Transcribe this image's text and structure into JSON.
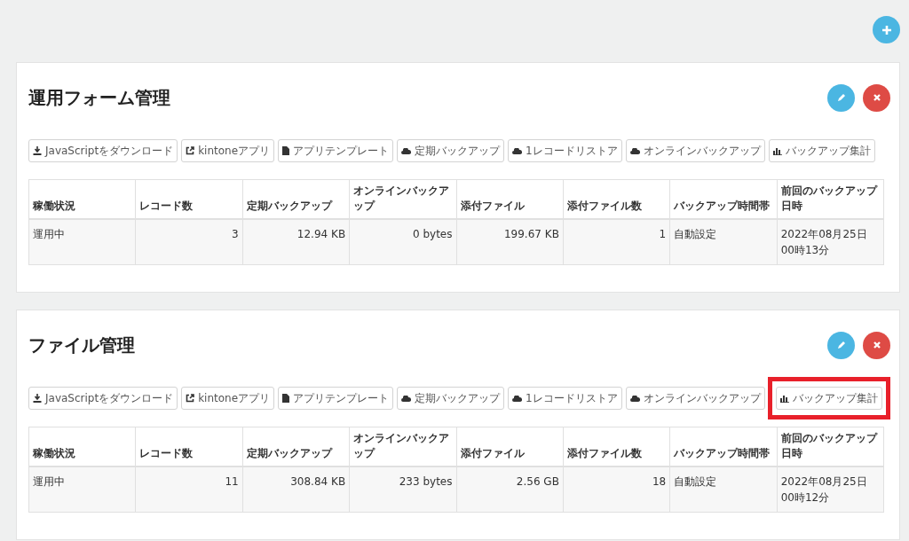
{
  "panels": [
    {
      "title": "運用フォーム管理",
      "buttons": [
        {
          "label": "JavaScriptをダウンロード",
          "kind": "download",
          "highlighted": false
        },
        {
          "label": "kintoneアプリ",
          "kind": "external",
          "highlighted": false
        },
        {
          "label": "アプリテンプレート",
          "kind": "file",
          "highlighted": false
        },
        {
          "label": "定期バックアップ",
          "kind": "cloud",
          "highlighted": false
        },
        {
          "label": "1レコードリストア",
          "kind": "cloud",
          "highlighted": false
        },
        {
          "label": "オンラインバックアップ",
          "kind": "cloud",
          "highlighted": false
        },
        {
          "label": "バックアップ集計",
          "kind": "chart",
          "highlighted": false
        }
      ],
      "table": {
        "columns": [
          {
            "label": "稼働状況",
            "kind": "text"
          },
          {
            "label": "レコード数",
            "kind": "number"
          },
          {
            "label": "定期バックアップ",
            "kind": "number"
          },
          {
            "label": "オンラインバックアップ",
            "kind": "number"
          },
          {
            "label": "添付ファイル",
            "kind": "number"
          },
          {
            "label": "添付ファイル数",
            "kind": "number"
          },
          {
            "label": "バックアップ時間帯",
            "kind": "text"
          },
          {
            "label": "前回のバックアップ日時",
            "kind": "text"
          }
        ],
        "rows": [
          [
            "運用中",
            "3",
            "12.94 KB",
            "0 bytes",
            "199.67 KB",
            "1",
            "自動設定",
            "2022年08月25日00時13分"
          ]
        ]
      }
    },
    {
      "title": "ファイル管理",
      "buttons": [
        {
          "label": "JavaScriptをダウンロード",
          "kind": "download",
          "highlighted": false
        },
        {
          "label": "kintoneアプリ",
          "kind": "external",
          "highlighted": false
        },
        {
          "label": "アプリテンプレート",
          "kind": "file",
          "highlighted": false
        },
        {
          "label": "定期バックアップ",
          "kind": "cloud",
          "highlighted": false
        },
        {
          "label": "1レコードリストア",
          "kind": "cloud",
          "highlighted": false
        },
        {
          "label": "オンラインバックアップ",
          "kind": "cloud",
          "highlighted": false
        },
        {
          "label": "バックアップ集計",
          "kind": "chart",
          "highlighted": true
        }
      ],
      "table": {
        "columns": [
          {
            "label": "稼働状況",
            "kind": "text"
          },
          {
            "label": "レコード数",
            "kind": "number"
          },
          {
            "label": "定期バックアップ",
            "kind": "number"
          },
          {
            "label": "オンラインバックアップ",
            "kind": "number"
          },
          {
            "label": "添付ファイル",
            "kind": "number"
          },
          {
            "label": "添付ファイル数",
            "kind": "number"
          },
          {
            "label": "バックアップ時間帯",
            "kind": "text"
          },
          {
            "label": "前回のバックアップ日時",
            "kind": "text"
          }
        ],
        "rows": [
          [
            "運用中",
            "11",
            "308.84 KB",
            "233 bytes",
            "2.56 GB",
            "18",
            "自動設定",
            "2022年08月25日00時12分"
          ]
        ]
      }
    }
  ]
}
